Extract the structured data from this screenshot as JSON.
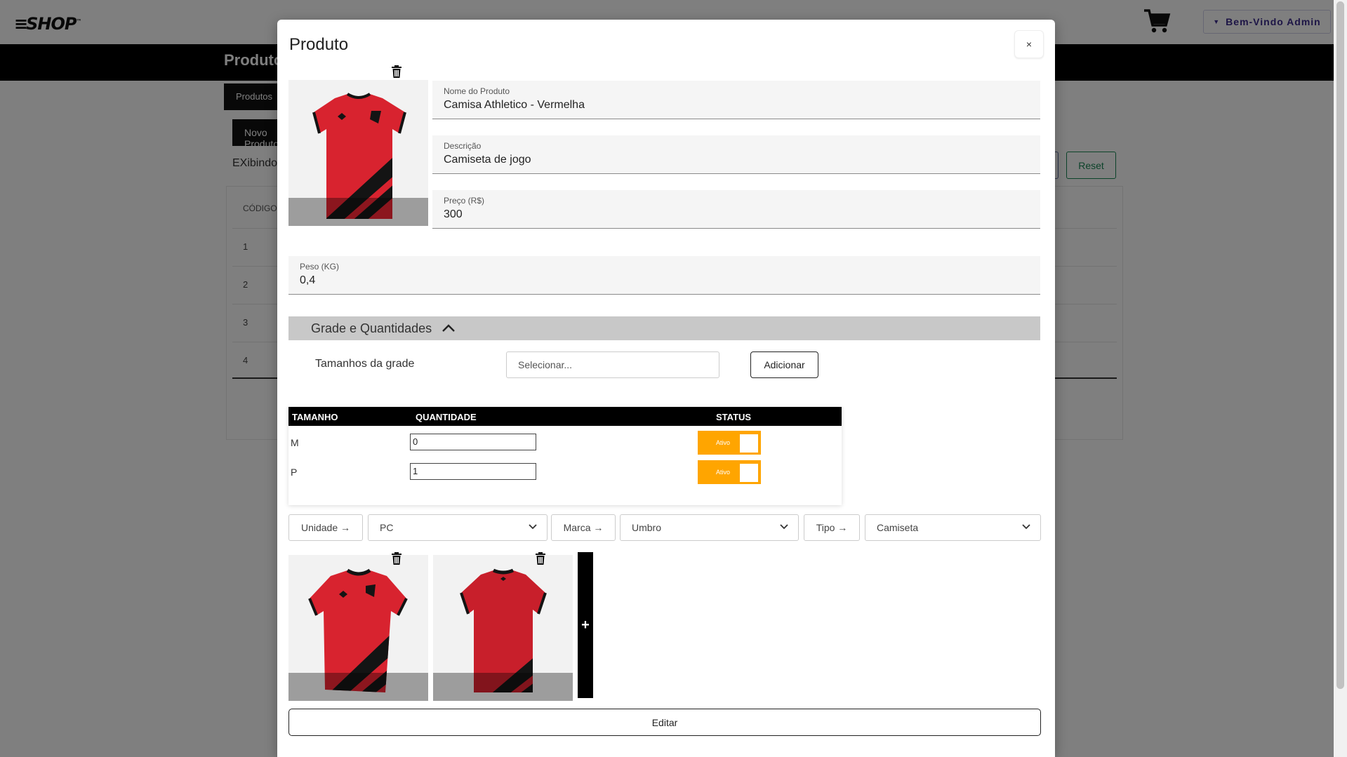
{
  "app": {
    "logo": "SHOP",
    "logo_mark": "™",
    "welcome": "Bem-Vindo Admin",
    "page_title": "Produtos",
    "tab_label": "Produtos",
    "new_button": "Novo Produto",
    "showing_text": "EXibindo",
    "reset_button": "Reset",
    "table_header_code": "CÓDIGO",
    "rows": [
      "1",
      "2",
      "3",
      "4"
    ]
  },
  "modal": {
    "title": "Produto",
    "close": "×",
    "fields": {
      "name_label": "Nome do Produto",
      "name_value": "Camisa Athletico - Vermelha",
      "desc_label": "Descrição",
      "desc_value": "Camiseta de jogo",
      "price_label": "Preço (R$)",
      "price_value": "300",
      "weight_label": "Peso (KG)",
      "weight_value": "0,4"
    },
    "grade": {
      "title": "Grade e Quantidades",
      "sizes_label": "Tamanhos da grade",
      "select_placeholder": "Selecionar...",
      "add_button": "Adicionar",
      "headers": {
        "size": "TAMANHO",
        "qty": "QUANTIDADE",
        "status": "STATUS"
      },
      "rows": [
        {
          "size": "M",
          "qty": "0",
          "status": "Ativo"
        },
        {
          "size": "P",
          "qty": "1",
          "status": "Ativo"
        }
      ]
    },
    "selectors": {
      "unit_button": "Unidade →",
      "unit_value": "PC",
      "brand_button": "Marca →",
      "brand_value": "Umbro",
      "type_button": "Tipo →",
      "type_value": "Camiseta"
    },
    "add_image": "+",
    "edit_button": "Editar"
  },
  "colors": {
    "toggle_on": "#ffa500",
    "shirt_red": "#d8232f",
    "shirt_black": "#141414"
  }
}
